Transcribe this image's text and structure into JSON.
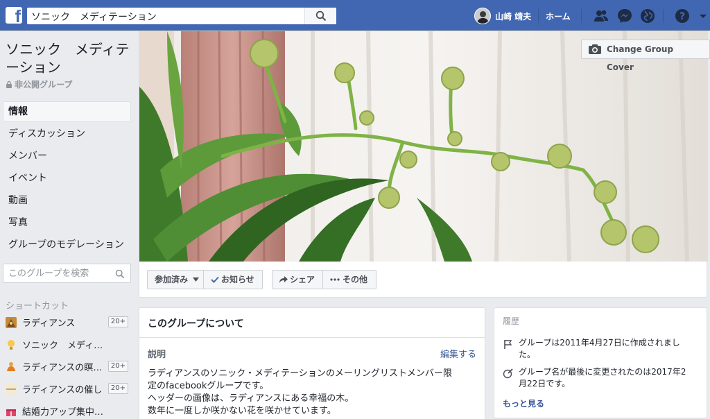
{
  "topbar": {
    "search_value": "ソニック　メディテーション",
    "user_name": "山崎 靖夫",
    "home_label": "ホーム"
  },
  "group": {
    "title": "ソニック　メディテーション",
    "privacy": "非公開グループ"
  },
  "nav": {
    "items": [
      {
        "label": "情報",
        "active": true
      },
      {
        "label": "ディスカッション"
      },
      {
        "label": "メンバー"
      },
      {
        "label": "イベント"
      },
      {
        "label": "動画"
      },
      {
        "label": "写真"
      },
      {
        "label": "グループのモデレーション"
      }
    ]
  },
  "group_search": {
    "placeholder": "このグループを検索"
  },
  "shortcuts": {
    "heading": "ショートカット",
    "items": [
      {
        "label": "ラディアンス",
        "badge": "20+"
      },
      {
        "label": "ソニック　メディテーション",
        "badge": ""
      },
      {
        "label": "ラディアンスの瞑想会",
        "badge": "20+"
      },
      {
        "label": "ラディアンスの催し",
        "badge": "20+"
      },
      {
        "label": "結婚力アップ集中プログラム",
        "badge": ""
      }
    ]
  },
  "cover": {
    "change_label": "Change Group Cover"
  },
  "actions": {
    "joined": "参加済み",
    "notifications": "お知らせ",
    "share": "シェア",
    "more": "その他"
  },
  "about": {
    "title": "このグループについて",
    "desc_label": "説明",
    "edit_label": "編集する",
    "lines": [
      "ラディアンスのソニック・メディテーションのメーリングリストメンバー限",
      "定のfacebookグループです。",
      "ヘッダーの画像は、ラディアンスにある幸福の木。",
      "数年に一度しか咲かない花を咲かせています。"
    ]
  },
  "history": {
    "heading": "履歴",
    "created_lines": [
      "グループは2011年4月27日に作成されまし",
      "た。"
    ],
    "renamed_lines": [
      "グループ名が最後に変更されたのは2017年2",
      "月22日です。"
    ],
    "more_label": "もっと見る"
  }
}
